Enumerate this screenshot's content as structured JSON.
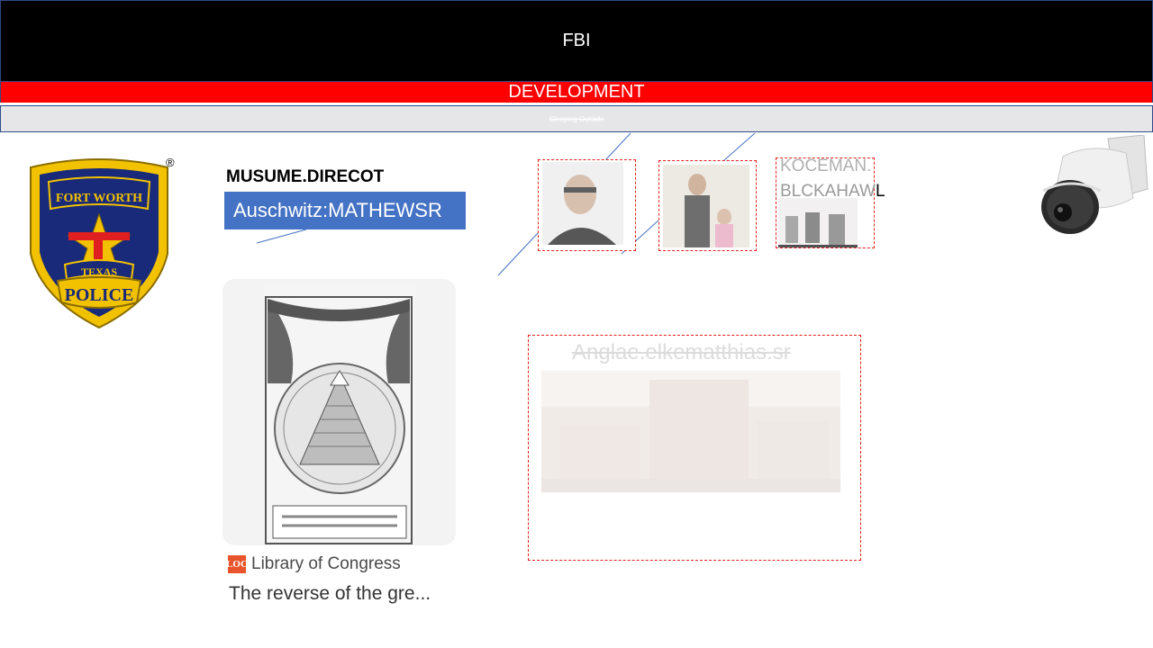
{
  "header": {
    "title": "FBI",
    "banner": "DEVELOPMENT",
    "subtitle": "Sleeping Outside"
  },
  "badge": {
    "lines": [
      "FORT WORTH",
      "TEXAS",
      "POLICE"
    ],
    "registered_mark": "®"
  },
  "profile": {
    "role_label": "MUSUME.DIRECOT",
    "name_tag": "Auschwitz:MATHEWSR"
  },
  "card": {
    "source": "Library of Congress",
    "source_logo": "LOC",
    "title": "The reverse of the gre..."
  },
  "photos": {
    "koceman": "KOCEMAN.",
    "blckahawl_start": "BLCKAHAW",
    "blckahawl_end": "L"
  },
  "location": {
    "label": "Anglae.elkematthias.sr"
  },
  "icons": {
    "camera": "security-camera-icon",
    "badge": "police-badge-icon"
  },
  "colors": {
    "banner_red": "#ff0000",
    "name_box": "#4472c4",
    "frame_border": "#e02020"
  }
}
